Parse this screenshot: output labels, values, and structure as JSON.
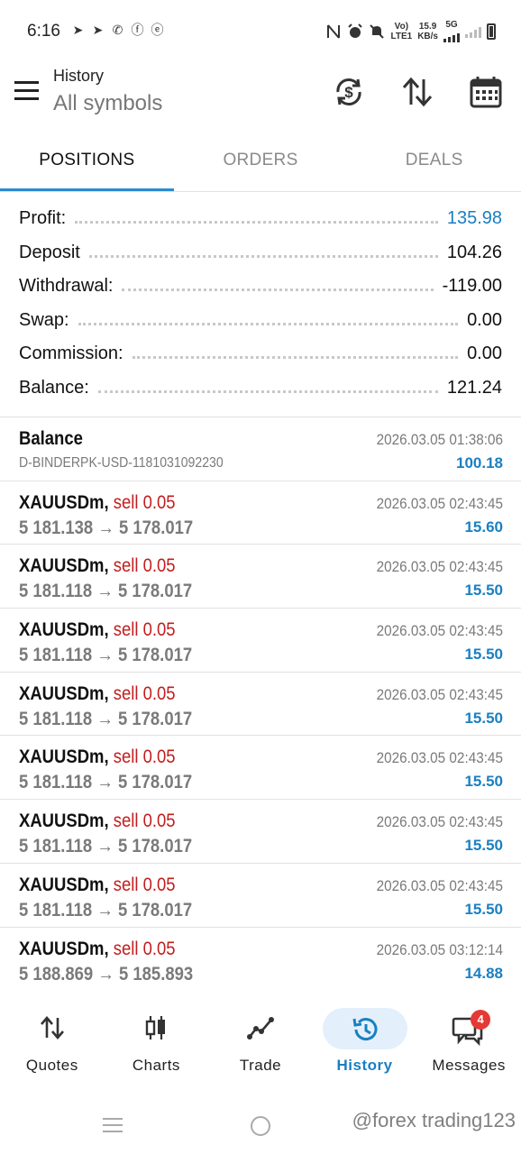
{
  "status_bar": {
    "time": "6:16",
    "vo_lte": "Vo)\nLTE1",
    "speed": "15.9\nKB/s",
    "net": "5G"
  },
  "header": {
    "title": "History",
    "subtitle": "All symbols"
  },
  "tabs": [
    {
      "label": "POSITIONS",
      "active": true
    },
    {
      "label": "ORDERS",
      "active": false
    },
    {
      "label": "DEALS",
      "active": false
    }
  ],
  "summary": [
    {
      "label": "Profit:",
      "value": "135.98"
    },
    {
      "label": "Deposit",
      "value": "104.26"
    },
    {
      "label": "Withdrawal:",
      "value": "-119.00"
    },
    {
      "label": "Swap:",
      "value": "0.00"
    },
    {
      "label": "Commission:",
      "value": "0.00"
    },
    {
      "label": "Balance:",
      "value": "121.24"
    }
  ],
  "deals": [
    {
      "symbol": "Balance",
      "side": "",
      "detail": "D-BINDERPK-USD-1181031092230",
      "time": "2026.03.05 01:38:06",
      "amount": "100.18"
    },
    {
      "symbol": "XAUUSDm,",
      "side": "sell 0.05",
      "detail": "5 181.138 → 5 178.017",
      "time": "2026.03.05 02:43:45",
      "amount": "15.60"
    },
    {
      "symbol": "XAUUSDm,",
      "side": "sell 0.05",
      "detail": "5 181.118 → 5 178.017",
      "time": "2026.03.05 02:43:45",
      "amount": "15.50"
    },
    {
      "symbol": "XAUUSDm,",
      "side": "sell 0.05",
      "detail": "5 181.118 → 5 178.017",
      "time": "2026.03.05 02:43:45",
      "amount": "15.50"
    },
    {
      "symbol": "XAUUSDm,",
      "side": "sell 0.05",
      "detail": "5 181.118 → 5 178.017",
      "time": "2026.03.05 02:43:45",
      "amount": "15.50"
    },
    {
      "symbol": "XAUUSDm,",
      "side": "sell 0.05",
      "detail": "5 181.118 → 5 178.017",
      "time": "2026.03.05 02:43:45",
      "amount": "15.50"
    },
    {
      "symbol": "XAUUSDm,",
      "side": "sell 0.05",
      "detail": "5 181.118 → 5 178.017",
      "time": "2026.03.05 02:43:45",
      "amount": "15.50"
    },
    {
      "symbol": "XAUUSDm,",
      "side": "sell 0.05",
      "detail": "5 181.118 → 5 178.017",
      "time": "2026.03.05 02:43:45",
      "amount": "15.50"
    },
    {
      "symbol": "XAUUSDm,",
      "side": "sell 0.05",
      "detail": "5 188.869 → 5 185.893",
      "time": "2026.03.05 03:12:14",
      "amount": "14.88"
    }
  ],
  "bottom_nav": [
    {
      "label": "Quotes",
      "icon": "quotes-icon"
    },
    {
      "label": "Charts",
      "icon": "charts-icon"
    },
    {
      "label": "Trade",
      "icon": "trade-icon"
    },
    {
      "label": "History",
      "icon": "history-icon",
      "active": true
    },
    {
      "label": "Messages",
      "icon": "messages-icon",
      "badge": "4"
    }
  ],
  "watermark": "@forex trading123",
  "colors": {
    "accent": "#1a7fc2",
    "sell": "#c21d1d",
    "tab_underline": "#2a8bd1",
    "badge": "#e53935"
  }
}
